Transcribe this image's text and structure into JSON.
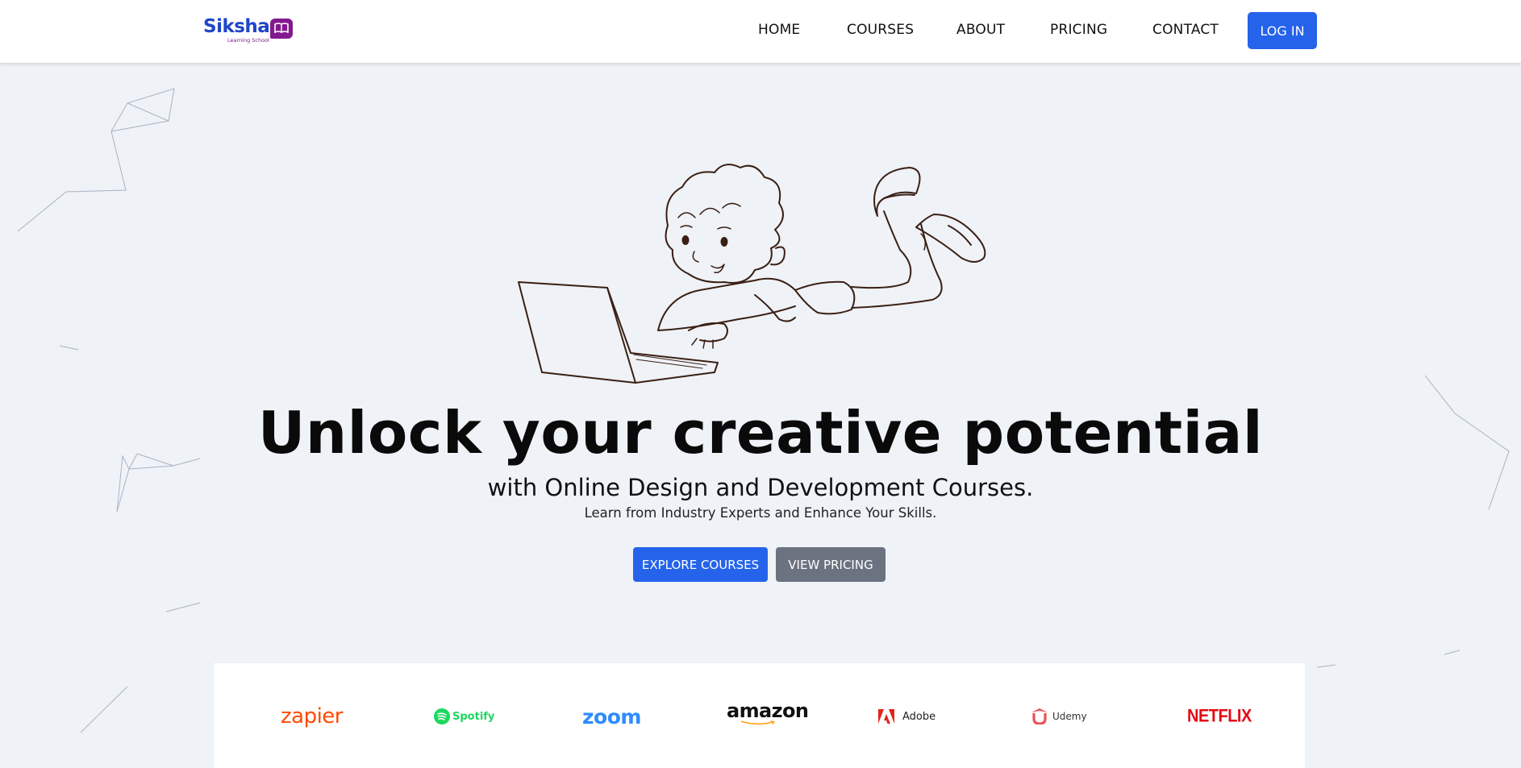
{
  "header": {
    "logo": {
      "name": "Siksha",
      "tagline": "Learning School"
    },
    "nav": [
      {
        "label": "HOME"
      },
      {
        "label": "COURSES"
      },
      {
        "label": "ABOUT"
      },
      {
        "label": "PRICING"
      },
      {
        "label": "CONTACT"
      }
    ],
    "login_label": "LOG IN"
  },
  "hero": {
    "headline": "Unlock your creative potential",
    "subheadline": "with Online Design and Development Courses.",
    "tagline": "Learn from Industry Experts and Enhance Your Skills.",
    "primary_button": "EXPLORE COURSES",
    "secondary_button": "VIEW PRICING",
    "illustration": "boy-lying-with-laptop-sketch"
  },
  "partners": [
    {
      "name": "zapier",
      "icon": "zapier-logo"
    },
    {
      "name": "Spotify",
      "icon": "spotify-logo"
    },
    {
      "name": "zoom",
      "icon": "zoom-logo"
    },
    {
      "name": "amazon",
      "icon": "amazon-logo"
    },
    {
      "name": "Adobe",
      "icon": "adobe-logo"
    },
    {
      "name": "Udemy",
      "icon": "udemy-logo"
    },
    {
      "name": "NETFLIX",
      "icon": "netflix-logo"
    }
  ],
  "colors": {
    "primary": "#2563eb",
    "secondary_button": "#6b7280",
    "page_background": "#eff2f7",
    "logo_blue": "#1f45c9",
    "logo_purple": "#84198f"
  }
}
